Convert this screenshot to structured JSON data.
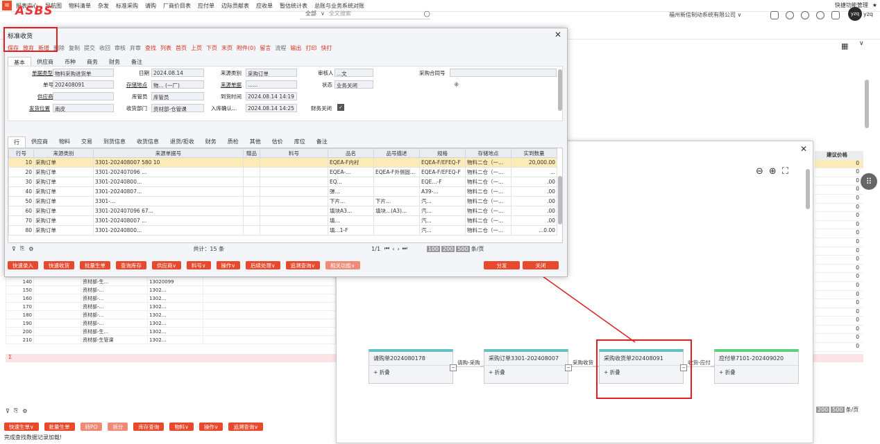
{
  "topnav": {
    "menu_icon": "menu-icon",
    "items": [
      "报表中心",
      "导航图",
      "物料清单",
      "杂发",
      "标准采购",
      "请购",
      "厂商价目表",
      "应付单",
      "边际贡献表",
      "应收单",
      "暂估统计表",
      "总账与业务系统对账"
    ],
    "right_label": "快捷功能管理"
  },
  "header": {
    "logo": "ASBS",
    "search_scope": "全部",
    "search_placeholder": "全文搜索",
    "company": "福州新信制动系统有限公司",
    "user_initials": "yzq",
    "user_name": "yzq"
  },
  "dialog": {
    "title": "标准收货",
    "toolbar": [
      "保存",
      "放弃",
      "新增",
      "删除",
      "复制",
      "提交",
      "收回",
      "审核",
      "弃审",
      "查找",
      "列表",
      "首页",
      "上页",
      "下页",
      "末页",
      "附件(0)",
      "留言",
      "流程",
      "输出",
      "打印",
      "快打"
    ],
    "header_tabs": [
      "基本",
      "供应商",
      "币种",
      "商务",
      "财务",
      "备注"
    ],
    "form": {
      "doc_type_label": "单据类型",
      "doc_type": "物料采购进货单",
      "doc_no_label": "单号",
      "doc_no": "202408091",
      "supplier_label": "供应商",
      "supplier": "",
      "ship_loc_label": "发货位置",
      "ship_loc": "南皮",
      "date_label": "日期",
      "date": "2024.08.14",
      "storage_label": "存储地点",
      "storage": "物... (一厂)",
      "keeper_label": "库管员",
      "keeper": "库管员",
      "recv_dept_label": "收货部门",
      "recv_dept": "资材部-仓管课",
      "src_type_label": "来源类别",
      "src_type": "采购订单",
      "src_doc_label": "来源单据",
      "src_doc": "......",
      "arrival_label": "到货时间",
      "arrival": "2024.08.14 14:19",
      "confirm_label": "入库确认...",
      "confirm": "2024.08.14 14:25",
      "auditor_label": "审核人",
      "auditor": "...文",
      "status_label": "状态",
      "status": "业务关闭",
      "fin_close_label": "财务关闭",
      "contract_label": "采购合同号",
      "contract": ""
    },
    "detail_tabs": [
      "行",
      "供应商",
      "物料",
      "交易",
      "到货信息",
      "收货信息",
      "退货/拒收",
      "财务",
      "质检",
      "其他",
      "估价",
      "库位",
      "备注"
    ],
    "columns": [
      "行号",
      "来源类别",
      "来源单据号",
      "赠品",
      "料号",
      "品名",
      "品号描述",
      "规格",
      "存储地点",
      "实到数量"
    ],
    "rows": [
      {
        "no": "10",
        "type": "采购订单",
        "src": "3301-202408007 580 10",
        "name": "EQEA-F内衬",
        "desc": "",
        "spec": "EQEA-F/EFEQ-F",
        "loc": "物料二仓（一...",
        "qty": "20,000.00"
      },
      {
        "no": "20",
        "type": "采购订单",
        "src": "3301-202407096 ...",
        "name": "EQEA-...",
        "desc": "EQEA-F外侧固...",
        "spec": "EQEA-F/EFEQ-F",
        "loc": "物料二仓（一...",
        "qty": "..."
      },
      {
        "no": "30",
        "type": "采购订单",
        "src": "3301-20240800...",
        "name": "EQ...",
        "desc": "",
        "spec": "EQE...-F",
        "loc": "物料二仓（一...",
        "qty": ".00"
      },
      {
        "no": "40",
        "type": "采购订单",
        "src": "3301-20240807...",
        "name": "弹...",
        "desc": "",
        "spec": "A39-...",
        "loc": "物料二仓（一...",
        "qty": ".00"
      },
      {
        "no": "50",
        "type": "采购订单",
        "src": "3301-...",
        "name": "下片...",
        "desc": "下片...",
        "spec": "汽...",
        "loc": "物料二仓（一...",
        "qty": ".00"
      },
      {
        "no": "60",
        "type": "采购订单",
        "src": "3301-202407096 67...",
        "name": "填块A3...",
        "desc": "填块...(A3)...",
        "spec": "汽...",
        "loc": "物料二仓（一...",
        "qty": ".00"
      },
      {
        "no": "70",
        "type": "采购订单",
        "src": "3301-202408007 ...",
        "name": "填...",
        "desc": "",
        "spec": "汽...",
        "loc": "物料二仓（一...",
        "qty": ".00"
      },
      {
        "no": "80",
        "type": "采购订单",
        "src": "3301-20240800...",
        "name": "填...1-F",
        "desc": "",
        "spec": "汽...",
        "loc": "物料二仓（一...",
        "qty": "...0.00"
      }
    ],
    "total_label": "共计：15 条",
    "pager": "1/1",
    "page_sizes": [
      "100",
      "200",
      "500"
    ],
    "page_unit": "条/页",
    "bottom_buttons": [
      "快速录入",
      "快速收货",
      "批量生单",
      "查询库存",
      "供应商∨",
      "料号∨",
      "操作∨",
      "后续处理∨",
      "追溯查询∨",
      "相关功能∨"
    ],
    "dispatch": "分发",
    "close": "关闭"
  },
  "bg_rows": [
    {
      "no": "140",
      "dept": "资材部-生...",
      "code": "13020099"
    },
    {
      "no": "150",
      "dept": "资材部-...",
      "code": "1302..."
    },
    {
      "no": "160",
      "dept": "资材部-...",
      "code": "1302..."
    },
    {
      "no": "170",
      "dept": "资材部-...",
      "code": "1302..."
    },
    {
      "no": "180",
      "dept": "资材部-...",
      "code": "1302..."
    },
    {
      "no": "190",
      "dept": "资材部-...",
      "code": "1302..."
    },
    {
      "no": "200",
      "dept": "资材部-生...",
      "code": "1302..."
    },
    {
      "no": "210",
      "dept": "资材部-生管课",
      "code": "1302..."
    }
  ],
  "sum_symbol": "Σ",
  "price": {
    "header": "建议价格",
    "values": [
      "0",
      "0",
      "0",
      "0",
      "0",
      "0",
      "0",
      "0",
      "0",
      "0",
      "0",
      "0",
      "0",
      "0",
      "0",
      "0",
      "0",
      "0",
      "0",
      "0",
      "0",
      "0"
    ]
  },
  "bg_pagesize": [
    "200",
    "500",
    "条/页"
  ],
  "bg_buttons": [
    "快速生单∨",
    "批量生单",
    "转PO",
    "拆分",
    "库存查询",
    "物料∨",
    "操作∨",
    "追溯查询∨"
  ],
  "status_text": "完成查找数据记录加载!",
  "flow": {
    "nodes": [
      {
        "title": "请购单2024080178",
        "fold": "折叠"
      },
      {
        "title": "采购订单3301-202408007",
        "fold": "折叠"
      },
      {
        "title": "采购收货单202408091",
        "fold": "折叠"
      },
      {
        "title": "应付单7101-202409020",
        "fold": "折叠"
      }
    ],
    "edges": [
      "请购-采购",
      "采购收货",
      "收货-应付"
    ]
  },
  "colors": {
    "accent": "#e8492c",
    "highlight": "#fdebb7",
    "annotation": "#e02020"
  }
}
